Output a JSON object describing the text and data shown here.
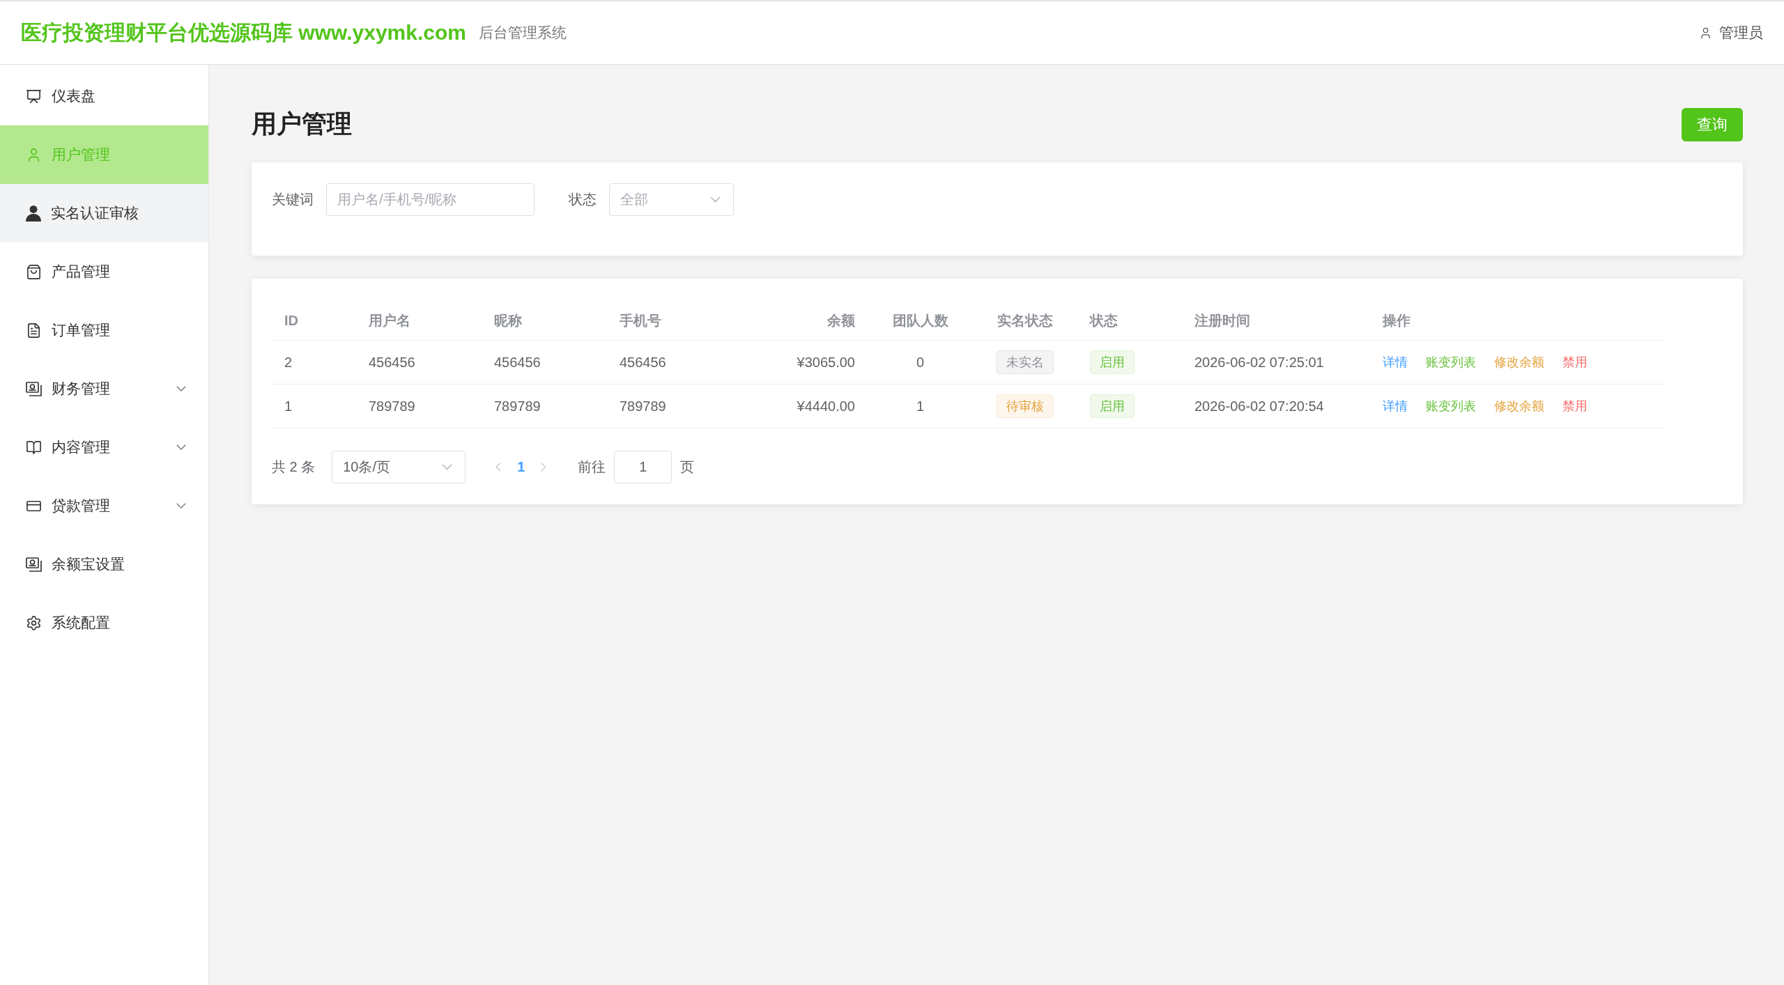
{
  "header": {
    "logo": "医疗投资理财平台优选源码库 www.yxymk.com",
    "subtitle": "后台管理系统",
    "user": "管理员"
  },
  "sidebar": {
    "items": [
      {
        "label": "仪表盘",
        "kind": "link",
        "selected": false,
        "hovered": false
      },
      {
        "label": "用户管理",
        "kind": "link",
        "selected": true,
        "hovered": false
      },
      {
        "label": "实名认证审核",
        "kind": "link",
        "selected": false,
        "hovered": true
      },
      {
        "label": "产品管理",
        "kind": "link",
        "selected": false,
        "hovered": false
      },
      {
        "label": "订单管理",
        "kind": "link",
        "selected": false,
        "hovered": false
      },
      {
        "label": "财务管理",
        "kind": "submenu",
        "selected": false,
        "hovered": false,
        "expanded": false
      },
      {
        "label": "内容管理",
        "kind": "submenu",
        "selected": false,
        "hovered": false,
        "expanded": false
      },
      {
        "label": "贷款管理",
        "kind": "submenu",
        "selected": false,
        "hovered": false,
        "expanded": false
      },
      {
        "label": "余额宝设置",
        "kind": "link",
        "selected": false,
        "hovered": false
      },
      {
        "label": "系统配置",
        "kind": "link",
        "selected": false,
        "hovered": false
      }
    ]
  },
  "page": {
    "title": "用户管理",
    "query_button": "查询"
  },
  "filters": [
    {
      "label": "关键词",
      "kind": "input",
      "placeholder": "用户名/手机号/昵称"
    },
    {
      "label": "状态",
      "kind": "select",
      "placeholder": "全部"
    }
  ],
  "table": {
    "columns": [
      "ID",
      "用户名",
      "昵称",
      "手机号",
      "余额",
      "团队人数",
      "实名状态",
      "状态",
      "注册时间",
      "操作"
    ],
    "rows": [
      {
        "id": "2",
        "username": "456456",
        "nickname": "456456",
        "phone": "456456",
        "balance": "¥3065.00",
        "team_size": "0",
        "verification": {
          "label": "未实名",
          "kind": "info"
        },
        "status": {
          "label": "启用",
          "kind": "success"
        },
        "registered_at": "2026-06-02 07:25:01",
        "actions": [
          {
            "label": "详情",
            "kind": "primary"
          },
          {
            "label": "账变列表",
            "kind": "success"
          },
          {
            "label": "修改余额",
            "kind": "warning"
          },
          {
            "label": "禁用",
            "kind": "danger"
          }
        ]
      },
      {
        "id": "1",
        "username": "789789",
        "nickname": "789789",
        "phone": "789789",
        "balance": "¥4440.00",
        "team_size": "1",
        "verification": {
          "label": "待审核",
          "kind": "warning"
        },
        "status": {
          "label": "启用",
          "kind": "success"
        },
        "registered_at": "2026-06-02 07:20:54",
        "actions": [
          {
            "label": "详情",
            "kind": "primary"
          },
          {
            "label": "账变列表",
            "kind": "success"
          },
          {
            "label": "修改余额",
            "kind": "warning"
          },
          {
            "label": "禁用",
            "kind": "danger"
          }
        ]
      }
    ]
  },
  "pagination": {
    "total": "共 2 条",
    "page_size": "10条/页",
    "prev": {
      "disabled": true
    },
    "pages": [
      {
        "label": "1",
        "selected": true
      }
    ],
    "next": {
      "disabled": true
    },
    "goto_label": "前往",
    "goto_value": "1",
    "goto_suffix": "页"
  }
}
